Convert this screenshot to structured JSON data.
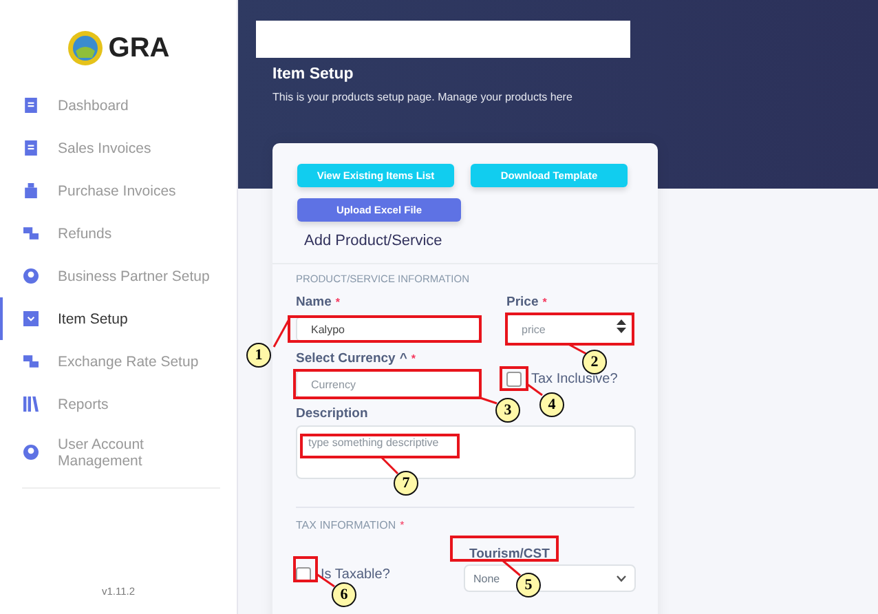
{
  "sidebar": {
    "logo": "GRA",
    "items": [
      {
        "label": "Dashboard",
        "selected": false
      },
      {
        "label": "Sales Invoices",
        "selected": false
      },
      {
        "label": "Purchase Invoices",
        "selected": false
      },
      {
        "label": "Refunds",
        "selected": false
      },
      {
        "label": "Business Partner Setup",
        "selected": false
      },
      {
        "label": "Item Setup",
        "selected": true
      },
      {
        "label": "Exchange Rate Setup",
        "selected": false
      },
      {
        "label": "Reports",
        "selected": false
      },
      {
        "label": "User Account Management",
        "selected": false
      }
    ],
    "version": "v1.11.2"
  },
  "header": {
    "title": "Item Setup",
    "subtitle": "This is your products setup page. Manage your products here"
  },
  "card": {
    "buttons": [
      {
        "label": "View Existing Items List",
        "kind": "cyan"
      },
      {
        "label": "Download Template",
        "kind": "cyan"
      },
      {
        "label": "Upload Excel File",
        "kind": "purple"
      }
    ],
    "title": "Add Product/Service",
    "section_1": "PRODUCT/SERVICE INFORMATION",
    "name": {
      "label": "Name",
      "required_mark": "*",
      "value": "Kalypo"
    },
    "price": {
      "label": "Price",
      "required_mark": "*",
      "placeholder": "price"
    },
    "currency": {
      "label": "Select Currency",
      "caret": "^",
      "required_mark": "*",
      "placeholder": "Currency"
    },
    "tax_inclusive": {
      "label": "Tax Inclusive?",
      "checked": false
    },
    "description": {
      "label": "Description",
      "placeholder": "type something descriptive"
    },
    "section_2": "TAX INFORMATION",
    "section_2_required_mark": "*",
    "is_taxable": {
      "label": "Is Taxable?",
      "checked": false
    },
    "tourism": {
      "label": "Tourism/CST",
      "value": "None"
    }
  },
  "callouts": [
    "1",
    "2",
    "3",
    "4",
    "5",
    "6",
    "7"
  ]
}
